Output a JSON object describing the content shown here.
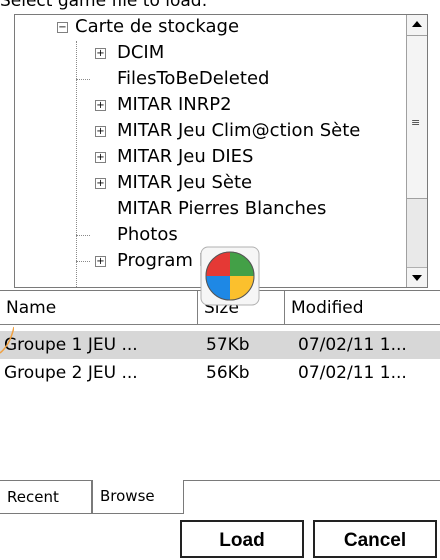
{
  "header": {
    "title": "Select game file to load:"
  },
  "tree": {
    "items": [
      {
        "label": "Carte de stockage",
        "expander": "⊟"
      },
      {
        "label": "DCIM",
        "expander": "+"
      },
      {
        "label": "FilesToBeDeleted",
        "expander": ""
      },
      {
        "label": "MITAR INRP2",
        "expander": "+"
      },
      {
        "label": "MITAR Jeu Clim@ction  Sète",
        "expander": "+"
      },
      {
        "label": "MITAR Jeu DIES",
        "expander": "+"
      },
      {
        "label": "MITAR Jeu Sète",
        "expander": "+"
      },
      {
        "label": "MITAR Pierres Blanches",
        "expander": ""
      },
      {
        "label": "Photos",
        "expander": ""
      },
      {
        "label": "Program Files",
        "expander": "+"
      }
    ]
  },
  "list": {
    "columns": [
      "Name",
      "Size",
      "Modified"
    ],
    "rows": [
      {
        "name": "Groupe 1 JEU ...",
        "size": "57Kb",
        "modified": "07/02/11 1...",
        "selected": true
      },
      {
        "name": "Groupe 2 JEU ...",
        "size": "56Kb",
        "modified": "07/02/11 1...",
        "selected": false
      }
    ]
  },
  "tabs": [
    "Recent",
    "Browse"
  ],
  "buttons": {
    "load": "Load",
    "cancel": "Cancel"
  },
  "icons": {
    "overlay": "windows-logo-icon",
    "scroll_up": "arrow-up-icon",
    "scroll_down": "arrow-down-icon"
  },
  "colors": {
    "selection": "#d7d7d7",
    "border": "#7a7a7a",
    "connector": "#f0a040"
  }
}
